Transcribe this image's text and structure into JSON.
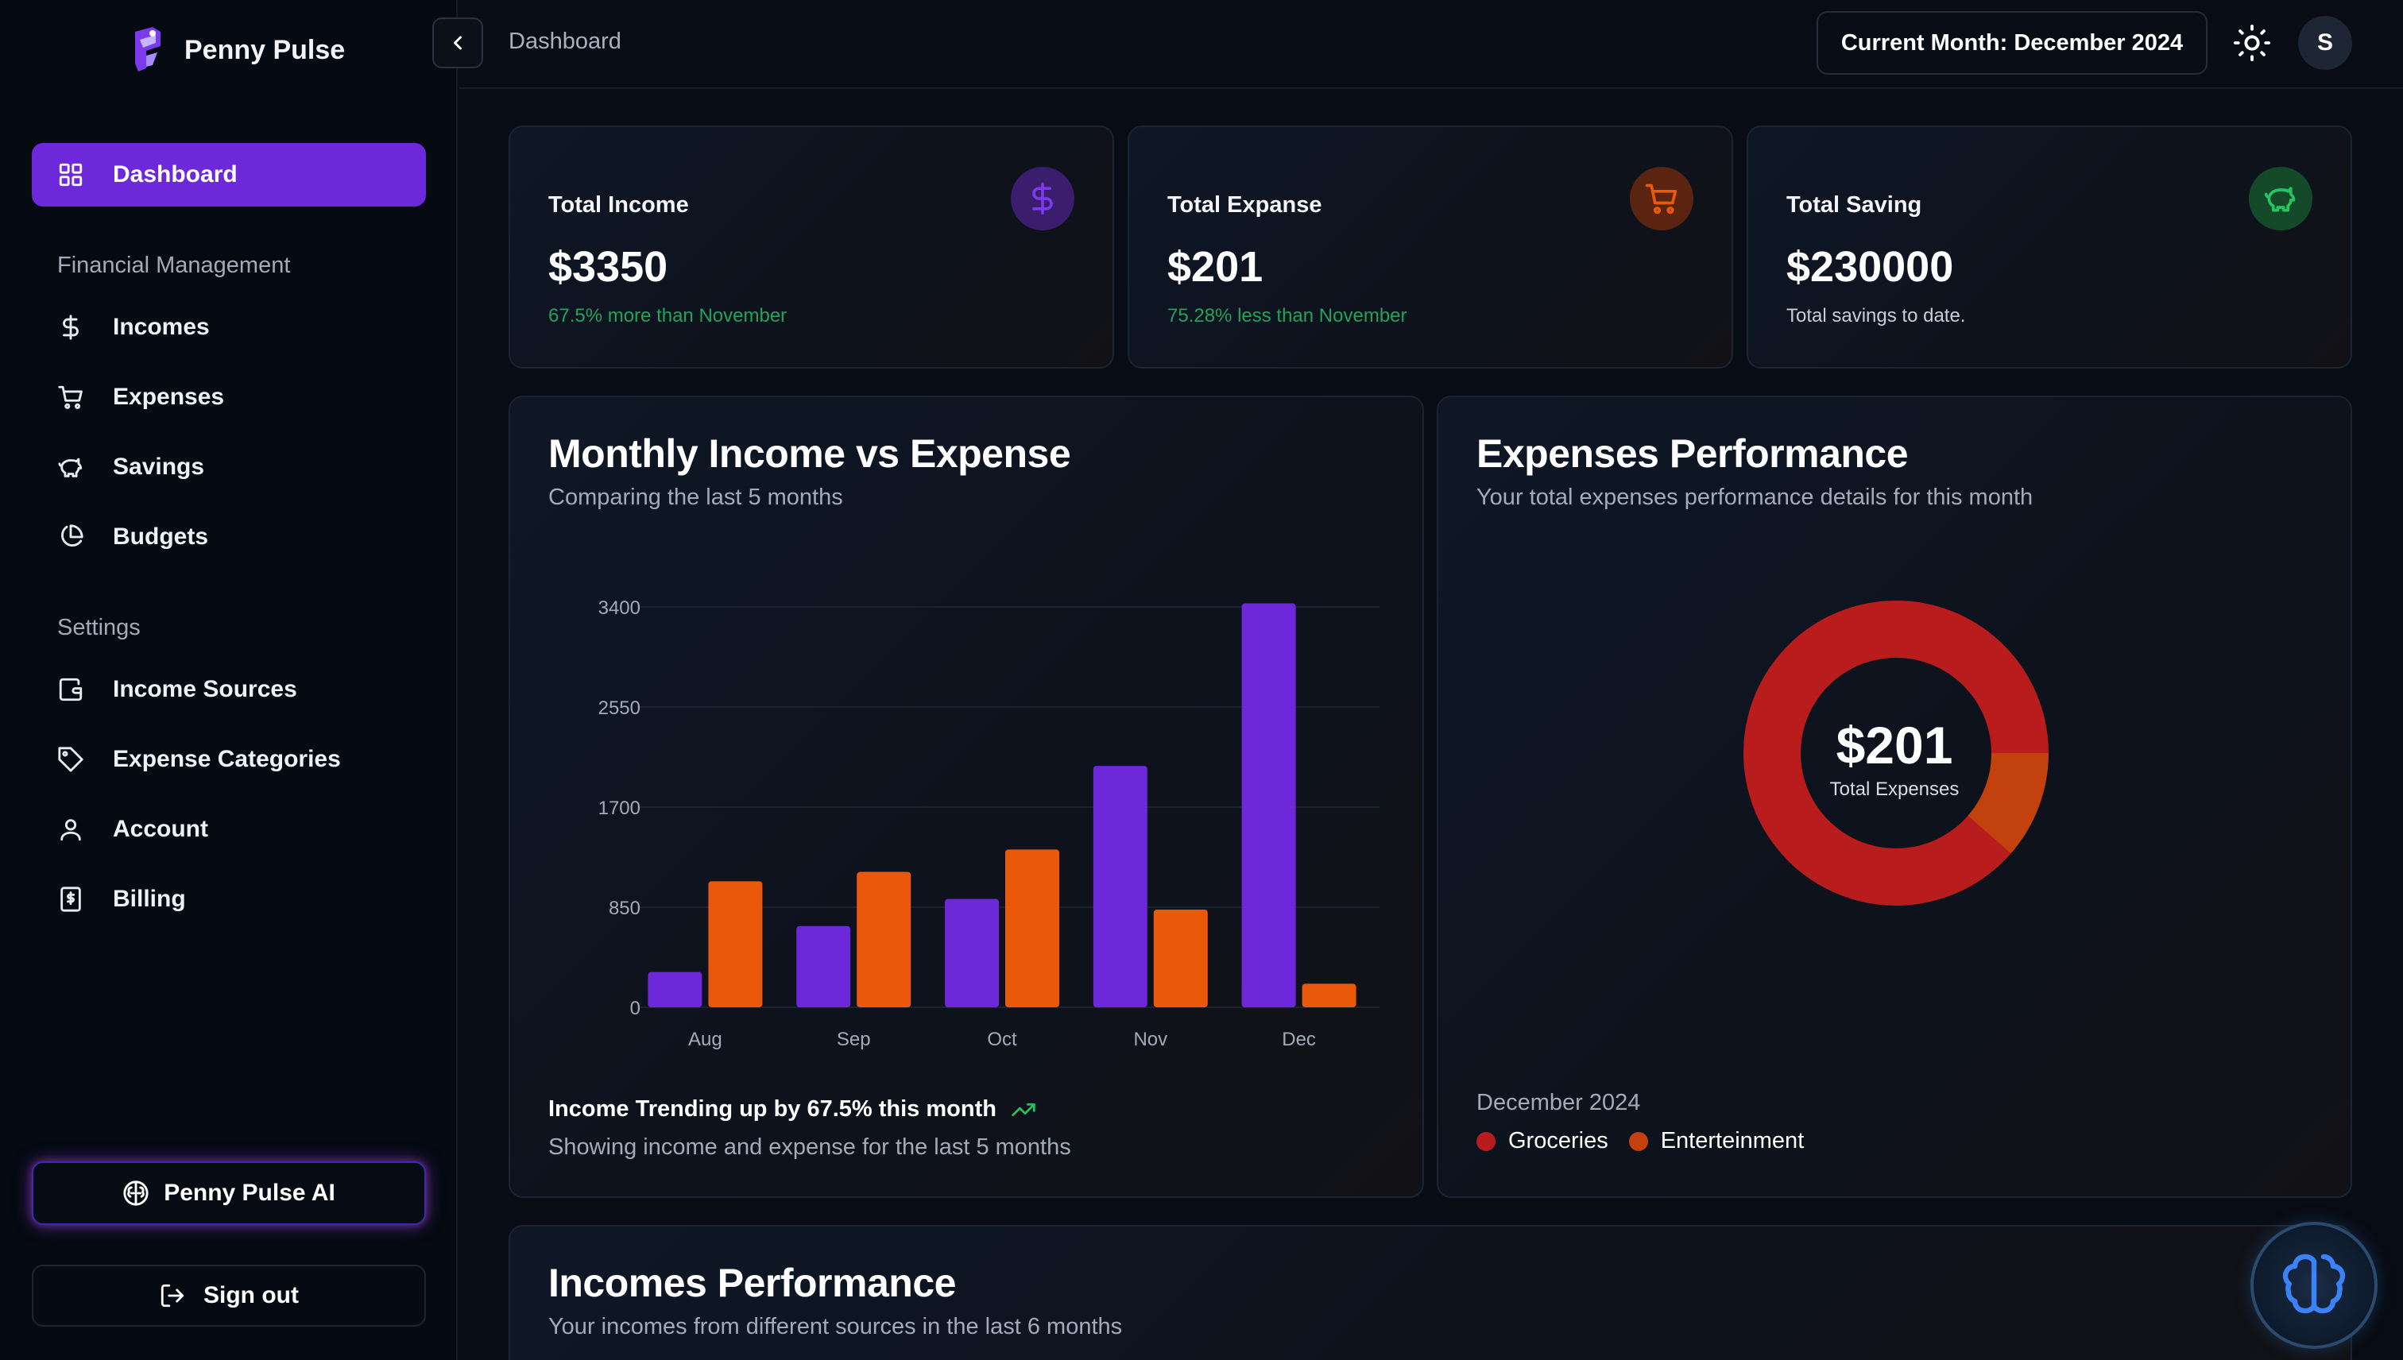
{
  "app": {
    "name": "Penny Pulse"
  },
  "sidebar": {
    "active_item": {
      "label": "Dashboard",
      "icon": "grid-icon"
    },
    "sections": [
      {
        "label": "Financial Management",
        "items": [
          {
            "label": "Incomes",
            "icon": "dollar-icon"
          },
          {
            "label": "Expenses",
            "icon": "cart-icon"
          },
          {
            "label": "Savings",
            "icon": "piggy-bank-icon"
          },
          {
            "label": "Budgets",
            "icon": "pie-chart-icon"
          }
        ]
      },
      {
        "label": "Settings",
        "items": [
          {
            "label": "Income Sources",
            "icon": "wallet-icon"
          },
          {
            "label": "Expense Categories",
            "icon": "tag-icon"
          },
          {
            "label": "Account",
            "icon": "user-icon"
          },
          {
            "label": "Billing",
            "icon": "receipt-icon"
          }
        ]
      }
    ],
    "ai_button": "Penny Pulse AI",
    "signout_button": "Sign out"
  },
  "topbar": {
    "breadcrumb": "Dashboard",
    "month_button": "Current Month: December 2024",
    "avatar_initial": "S"
  },
  "stats": [
    {
      "title": "Total Income",
      "value": "$3350",
      "sub": "67.5% more than November",
      "sub_color": "#22a35a",
      "icon": "dollar-icon",
      "icon_bg": "#3b1d6e",
      "icon_color": "#7c3aed"
    },
    {
      "title": "Total Expanse",
      "value": "$201",
      "sub": "75.28% less than November",
      "sub_color": "#22a35a",
      "icon": "cart-icon",
      "icon_bg": "#5a2411",
      "icon_color": "#ea580c"
    },
    {
      "title": "Total Saving",
      "value": "$230000",
      "sub": "Total savings to date.",
      "sub_color": "#c8ced8",
      "icon": "piggy-bank-icon",
      "icon_bg": "#144a2a",
      "icon_color": "#22c55e"
    }
  ],
  "income_vs_expense": {
    "title": "Monthly Income vs Expense",
    "subtitle": "Comparing the last 5 months",
    "trend_title": "Income Trending up by 67.5% this month",
    "trend_sub": "Showing income and expense for the last 5 months"
  },
  "expenses_performance": {
    "title": "Expenses Performance",
    "subtitle": "Your total expenses performance details for this month",
    "center_value": "$201",
    "center_label": "Total Expenses",
    "legend_date": "December 2024"
  },
  "incomes_performance": {
    "title": "Incomes Performance",
    "subtitle": "Your incomes from different sources in the last 6 months"
  },
  "colors": {
    "income": "#6d28d9",
    "expense": "#ea580c",
    "groceries": "#b91c1c",
    "entertainment": "#c2410c",
    "accent": "#6d28d9"
  },
  "chart_data": [
    {
      "type": "bar",
      "categories": [
        "Aug",
        "Sep",
        "Oct",
        "Nov",
        "Dec"
      ],
      "series": [
        {
          "values": [
            300,
            690,
            920,
            2050,
            3430
          ],
          "color": "#6d28d9"
        },
        {
          "values": [
            1070,
            1150,
            1340,
            830,
            200
          ],
          "color": "#ea580c"
        }
      ],
      "yticks": [
        0,
        850,
        1700,
        2550,
        3400
      ],
      "ylim": [
        0,
        3400
      ]
    },
    {
      "type": "pie",
      "labels": [
        "Groceries",
        "Enterteinment"
      ],
      "values": [
        178,
        23
      ],
      "colors": [
        "#b91c1c",
        "#c2410c"
      ]
    }
  ]
}
